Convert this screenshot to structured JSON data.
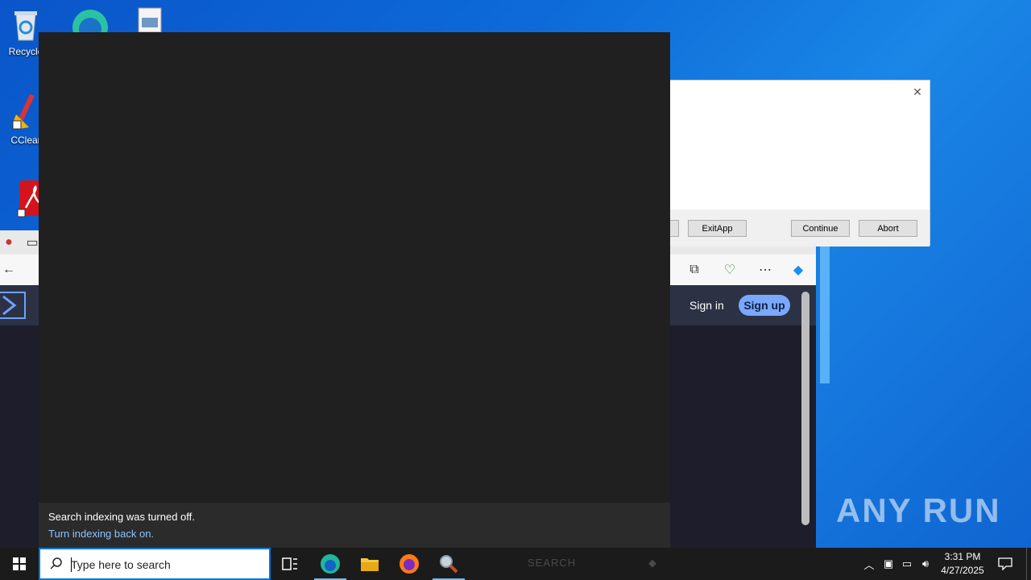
{
  "desktop": {
    "icons": [
      {
        "label": "Recycle",
        "icon": "recycle-bin-icon"
      },
      {
        "label": "CClear",
        "icon": "ccleaner-icon"
      },
      {
        "label": "",
        "icon": "edge-icon"
      },
      {
        "label": "",
        "icon": "file-icon"
      },
      {
        "label": "",
        "icon": "acrobat-icon"
      }
    ],
    "watermark": "ANY RUN"
  },
  "dialog": {
    "buttons": {
      "exitapp": "ExitApp",
      "continue": "Continue",
      "abort": "Abort"
    }
  },
  "browser": {
    "signin": "Sign in",
    "signup": "Sign up"
  },
  "search_panel": {
    "notice_title": "Search indexing was turned off.",
    "notice_link": "Turn indexing back on."
  },
  "taskbar": {
    "search_placeholder": "Type here to search",
    "faint_label": "SEARCH",
    "time": "3:31 PM",
    "date": "4/27/2025",
    "apps": [
      "task-view-icon",
      "edge-icon",
      "file-explorer-icon",
      "firefox-icon",
      "search-app-icon"
    ]
  },
  "colors": {
    "accent": "#0078d7",
    "link": "#8ac4ff",
    "signup_bg": "#7aa8ff"
  }
}
